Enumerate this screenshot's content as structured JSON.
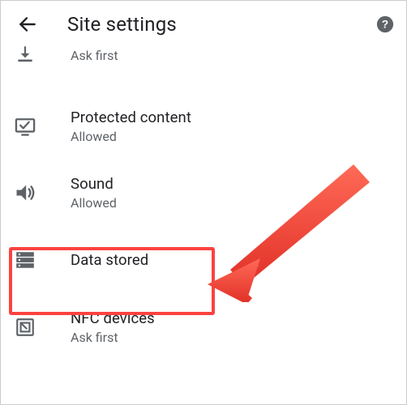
{
  "header": {
    "title": "Site settings"
  },
  "rows": [
    {
      "title": "",
      "sub": "Ask first",
      "icon": "download-icon"
    },
    {
      "title": "Protected content",
      "sub": "Allowed",
      "icon": "protected-icon"
    },
    {
      "title": "Sound",
      "sub": "Allowed",
      "icon": "sound-icon"
    },
    {
      "title": "Data stored",
      "sub": "",
      "icon": "storage-icon"
    },
    {
      "title": "NFC devices",
      "sub": "Ask first",
      "icon": "nfc-icon"
    }
  ]
}
